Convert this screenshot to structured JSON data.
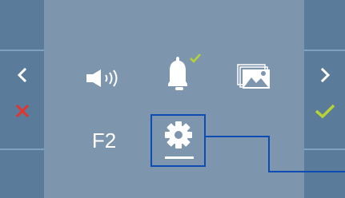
{
  "colors": {
    "background": "#7d95ad",
    "side_panel": "#5a7b99",
    "divider": "#7fa2bf",
    "accent_blue": "#0d4db3",
    "check_green": "#b5d334",
    "cross_red": "#e7322b",
    "icon_white": "#ffffff"
  },
  "left_panel": {
    "prev": {
      "icon": "chevron-left-icon"
    },
    "cancel": {
      "icon": "close-icon"
    }
  },
  "right_panel": {
    "next": {
      "icon": "chevron-right-icon"
    },
    "confirm": {
      "icon": "check-icon"
    }
  },
  "menu": {
    "volume": {
      "icon": "speaker-volume-icon"
    },
    "ringtone": {
      "icon": "bell-icon",
      "badge": "check-icon"
    },
    "gallery": {
      "icon": "gallery-icon"
    },
    "f2": {
      "label": "F2"
    },
    "settings": {
      "icon": "gear-icon",
      "selected": true
    }
  }
}
